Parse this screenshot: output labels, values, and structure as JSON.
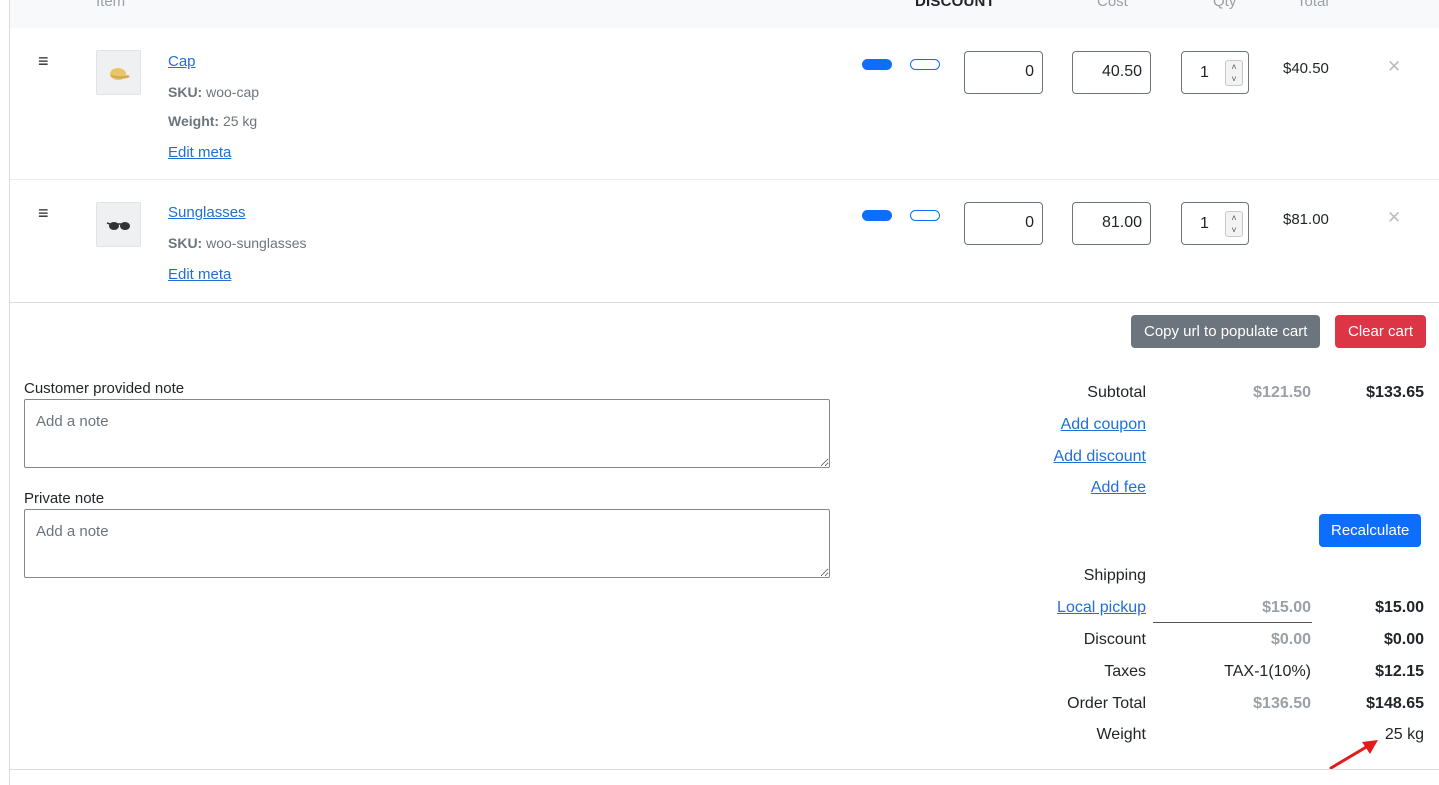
{
  "header": {
    "item": "Item",
    "discount": "DISCOUNT",
    "cost": "Cost",
    "qty": "Qty",
    "total": "Total"
  },
  "items": [
    {
      "name": "Cap",
      "sku_label": "SKU:",
      "sku": "woo-cap",
      "weight_label": "Weight:",
      "weight": "25 kg",
      "edit": "Edit meta",
      "discount": "0",
      "cost": "40.50",
      "qty": "1",
      "total": "$40.50"
    },
    {
      "name": "Sunglasses",
      "sku_label": "SKU:",
      "sku": "woo-sunglasses",
      "edit": "Edit meta",
      "discount": "0",
      "cost": "81.00",
      "qty": "1",
      "total": "$81.00"
    }
  ],
  "actions": {
    "copy_url": "Copy url to populate cart",
    "clear_cart": "Clear cart",
    "recalculate": "Recalculate"
  },
  "notes": {
    "customer_label": "Customer provided note",
    "private_label": "Private note",
    "placeholder": "Add a note"
  },
  "totals": {
    "subtotal_label": "Subtotal",
    "subtotal_before": "$121.50",
    "subtotal_after": "$133.65",
    "add_coupon": "Add coupon",
    "add_discount": "Add discount",
    "add_fee": "Add fee",
    "shipping_label": "Shipping",
    "local_pickup": "Local pickup",
    "shipping_before": "$15.00",
    "shipping_after": "$15.00",
    "discount_label": "Discount",
    "discount_before": "$0.00",
    "discount_after": "$0.00",
    "taxes_label": "Taxes",
    "tax_name": "TAX-1(10%)",
    "taxes_after": "$12.15",
    "order_total_label": "Order Total",
    "order_total_before": "$136.50",
    "order_total_after": "$148.65",
    "weight_label": "Weight",
    "weight_value": "25 kg"
  },
  "colors": {
    "primary": "#0d6efd",
    "danger": "#dc3545",
    "secondary": "#6c757d",
    "link": "#1f6fd6",
    "annotation_arrow": "#e31b1b"
  }
}
